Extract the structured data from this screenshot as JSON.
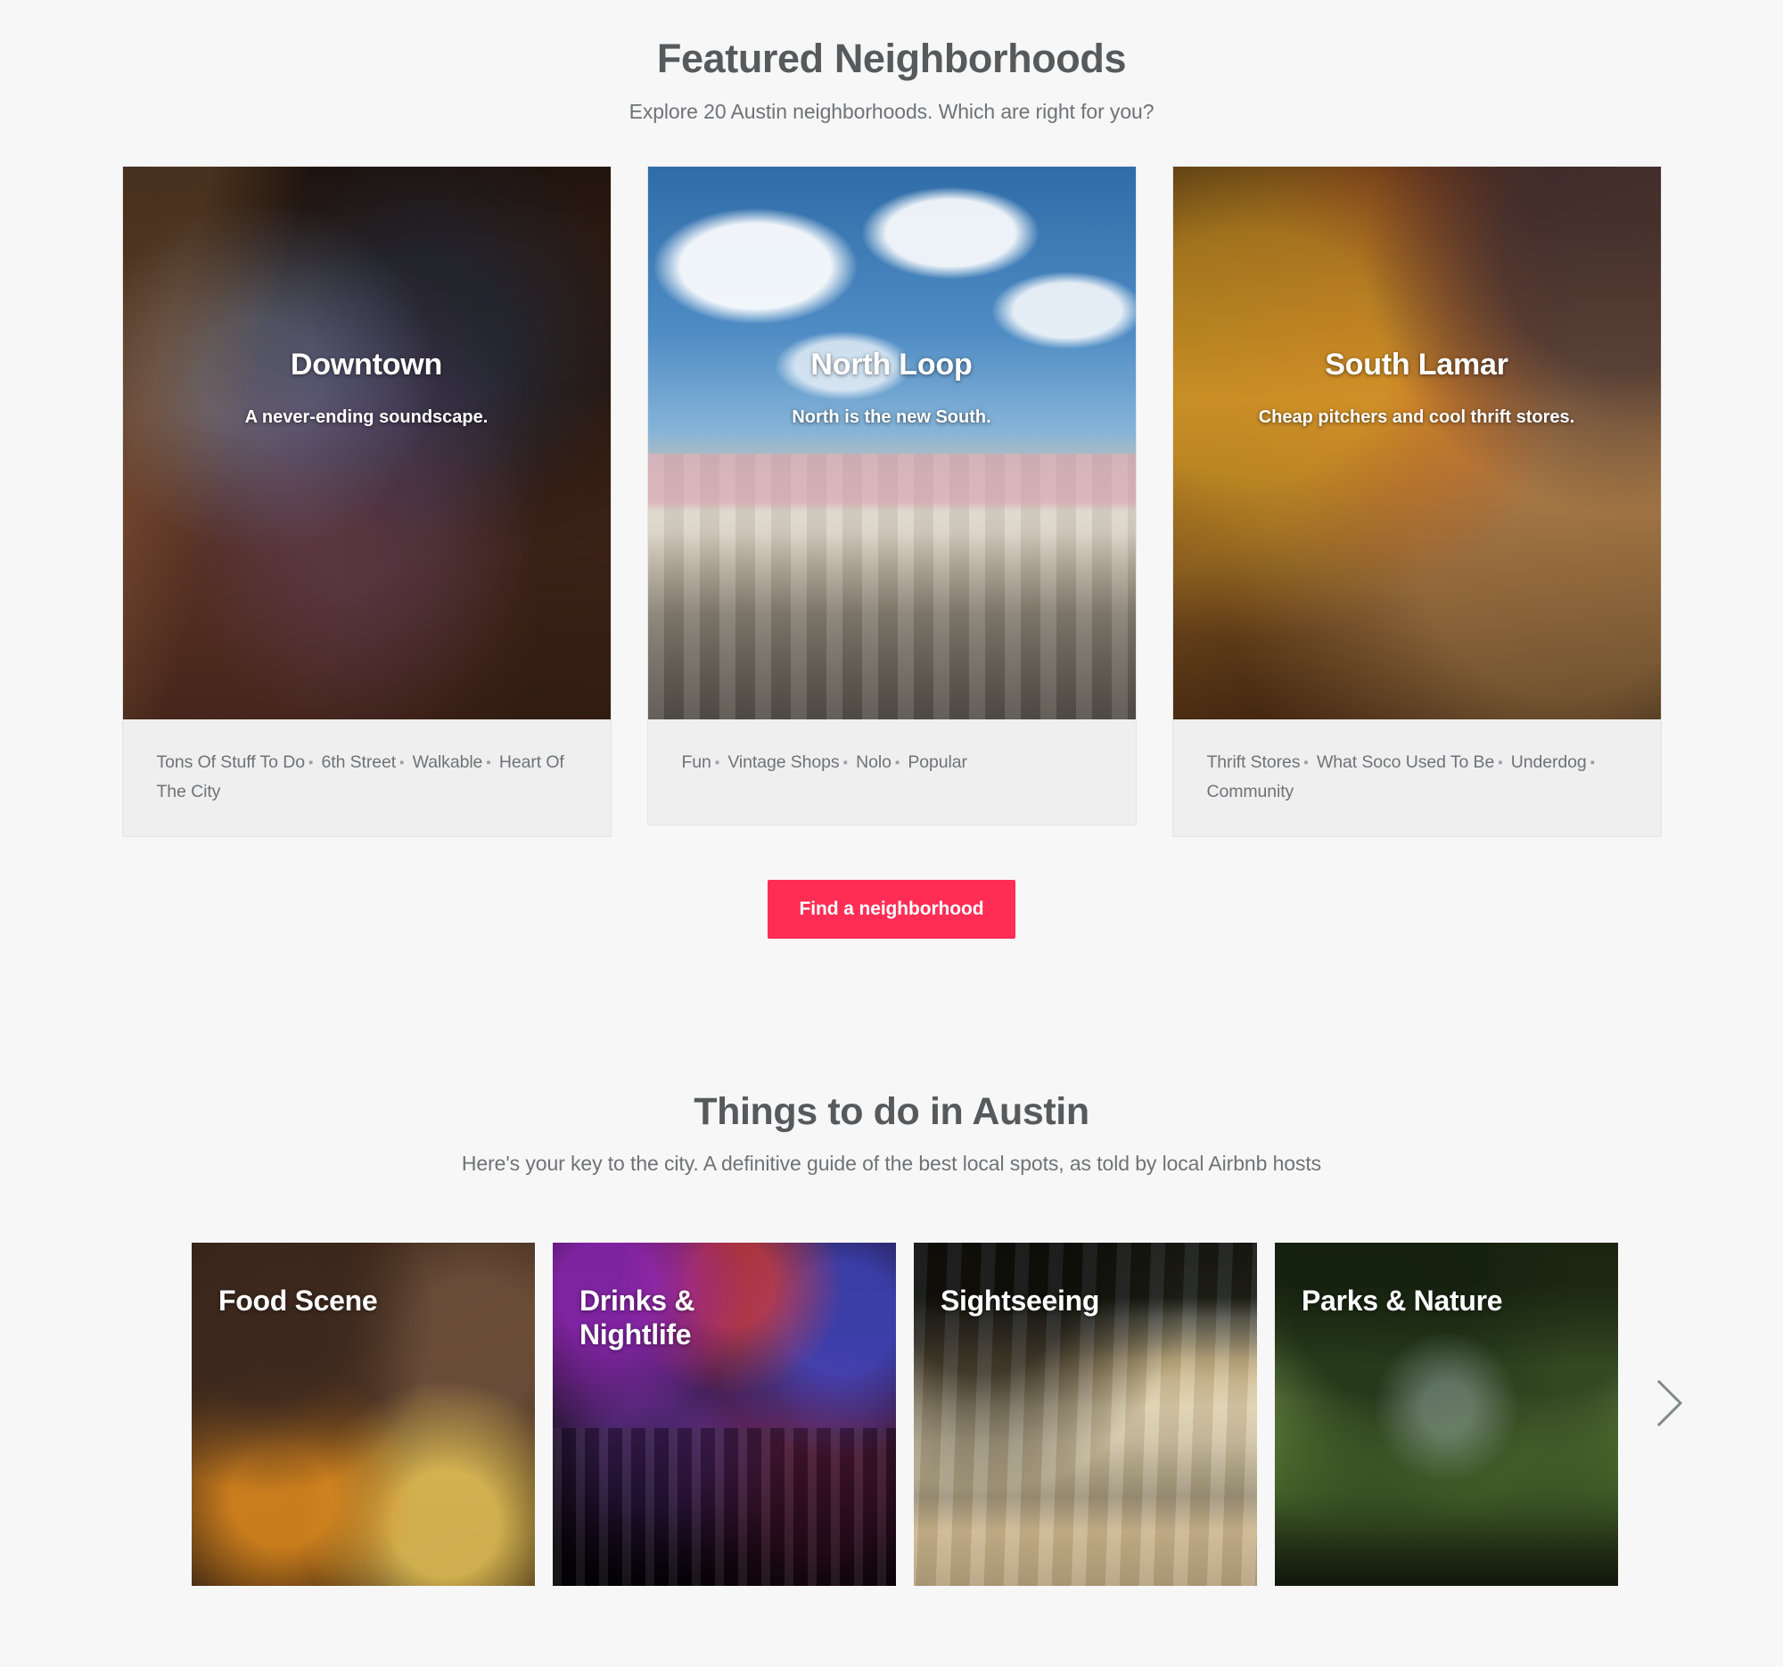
{
  "featured": {
    "title": "Featured Neighborhoods",
    "subtitle": "Explore 20 Austin neighborhoods. Which are right for you?",
    "cards": [
      {
        "name": "Downtown",
        "tagline": "A never-ending soundscape.",
        "tags": [
          "Tons Of Stuff To Do",
          "6th Street",
          "Walkable",
          "Heart Of The City"
        ]
      },
      {
        "name": "North Loop",
        "tagline": "North is the new South.",
        "tags": [
          "Fun",
          "Vintage Shops",
          "Nolo",
          "Popular"
        ]
      },
      {
        "name": "South Lamar",
        "tagline": "Cheap pitchers and cool thrift stores.",
        "tags": [
          "Thrift Stores",
          "What Soco Used To Be",
          "Underdog",
          "Community"
        ]
      }
    ],
    "cta_label": "Find a neighborhood",
    "cta_color": "#ff2d55"
  },
  "things": {
    "title": "Things to do in Austin",
    "subtitle": "Here's your key to the city. A definitive guide of the best local spots, as told by local Airbnb hosts",
    "cards": [
      {
        "title": "Food Scene"
      },
      {
        "title": "Drinks &\nNightlife"
      },
      {
        "title": "Sightseeing"
      },
      {
        "title": "Parks & Nature"
      }
    ],
    "next_icon": "chevron-right-icon"
  },
  "colors": {
    "page_background": "#f7f7f7",
    "card_footer_background": "#efefef",
    "heading": "#565a5c",
    "body_text": "#6f7375"
  }
}
